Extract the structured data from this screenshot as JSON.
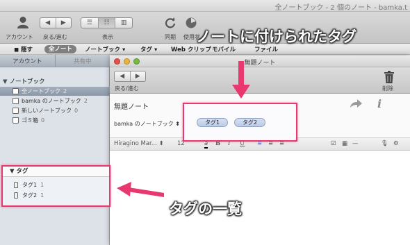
{
  "window": {
    "title": "全ノートブック - 2 個のノート - bamka.t"
  },
  "toolbar": {
    "account_label": "アカウント",
    "back_forward_label": "戻る/進む",
    "view_label": "表示",
    "sync_label": "同期",
    "status_label": "使用状",
    "view_modes": [
      "list",
      "snippet",
      "card"
    ]
  },
  "filter_bar": {
    "items": [
      "隠す",
      "全ノート",
      "ノートブック ▾",
      "タグ ▾",
      "Web クリップ",
      "モバイル",
      "ファイル"
    ]
  },
  "sidebar": {
    "tabs": [
      "アカウント",
      "共有中"
    ],
    "notebooks_header": "▼ ノートブック",
    "notebooks": [
      {
        "name": "全ノートブック",
        "count": "2",
        "selected": true
      },
      {
        "name": "bamka のノートブック",
        "count": "2",
        "selected": false
      },
      {
        "name": "新しいノートブック",
        "count": "0",
        "selected": false
      },
      {
        "name": "ゴミ箱",
        "count": "0",
        "selected": false
      }
    ],
    "tags_header": "▼ タグ",
    "tags": [
      {
        "name": "タグ1",
        "count": "1"
      },
      {
        "name": "タグ2",
        "count": "1"
      }
    ]
  },
  "note_window": {
    "title": "無題ノート",
    "back_forward_label": "戻る/進む",
    "delete_label": "削除",
    "note_title": "無題ノート",
    "notebook": "bamka のノートブック",
    "tags": [
      "タグ1",
      "タグ2"
    ],
    "font": "Hiragino Mar...",
    "font_size": "12",
    "format_buttons": [
      "B",
      "I",
      "U"
    ]
  },
  "annotations": {
    "tags_on_note": "ノートに付けられたタグ",
    "tag_list": "タグの一覧"
  },
  "colors": {
    "highlight": "#e8386f",
    "tag_pill": "#c9d6ec",
    "sidebar_selected": "#95a2b2"
  }
}
